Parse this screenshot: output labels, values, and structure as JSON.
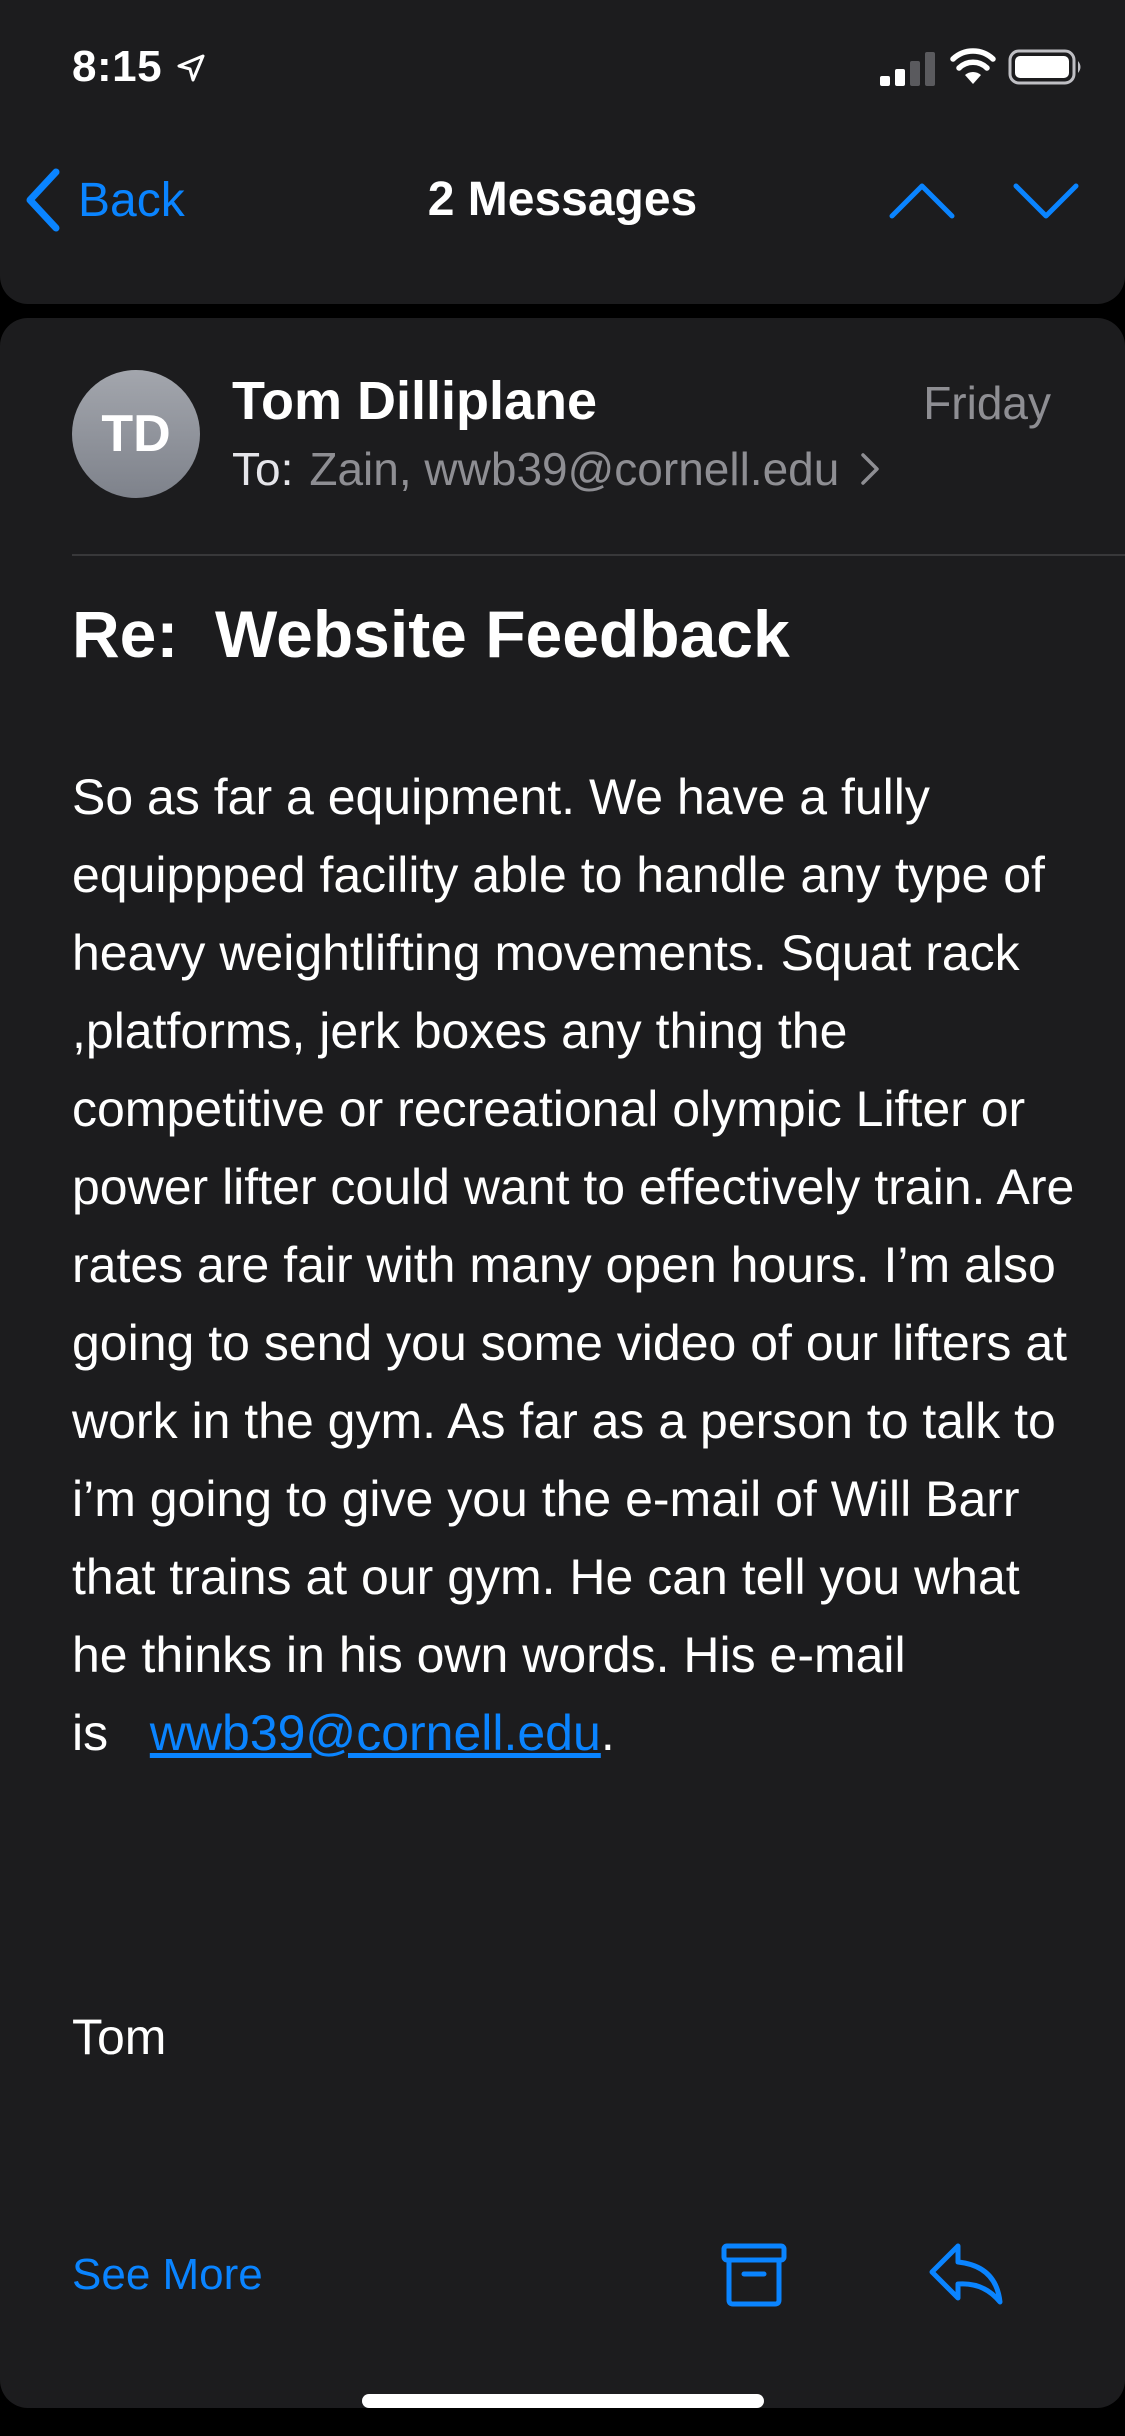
{
  "status_bar": {
    "time": "8:15",
    "icons": [
      "location-arrow-icon",
      "cellular-signal-icon",
      "wifi-icon",
      "battery-icon"
    ]
  },
  "nav": {
    "back_label": "Back",
    "title": "2 Messages",
    "icons": [
      "chevron-left-icon",
      "chevron-up-icon",
      "chevron-down-icon"
    ]
  },
  "message": {
    "avatar_initials": "TD",
    "sender": "Tom Dilliplane",
    "date": "Friday",
    "to_label": "To:",
    "recipients": "Zain, wwb39@cornell.edu",
    "subject": "Re:  Website Feedback",
    "body": "So as far a equipment. We have a fully equippped facility able to handle any type of heavy weightlifting movements. Squat rack ,platforms, jerk boxes any thing the competitive or recreational olympic Lifter or power lifter could want to effectively train. Are rates are fair with many open hours. I’m  also going to send you some video of our lifters at work in the gym. As far as a person to talk to i’m going to give you the e-mail of Will Barr that trains at our gym. He can tell you what he thinks in his own words. His e-mail is",
    "email_link": "wwb39@cornell.edu",
    "body_end": ".",
    "signoff": "Tom"
  },
  "actions": {
    "see_more": "See More",
    "icons": [
      "archive-icon",
      "reply-icon"
    ]
  },
  "colors": {
    "accent": "#0a84ff",
    "background": "#000000",
    "card": "#1c1c1e",
    "secondary_text": "#8e8e93"
  }
}
